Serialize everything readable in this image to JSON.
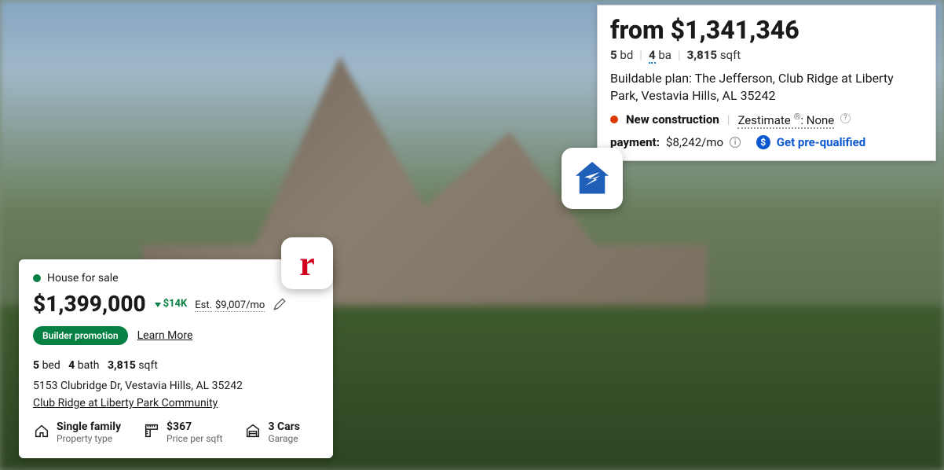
{
  "realtor": {
    "status": "House for sale",
    "price": "$1,399,000",
    "delta": "$14K",
    "est_label": "Est.",
    "est_value": "$9,007/mo",
    "promo_badge": "Builder promotion",
    "learn_more": "Learn More",
    "beds_value": "5",
    "beds_label": "bed",
    "baths_value": "4",
    "baths_label": "bath",
    "sqft_value": "3,815",
    "sqft_label": "sqft",
    "address": "5153 Clubridge Dr, Vestavia Hills, AL 35242",
    "community": "Club Ridge at Liberty Park Community",
    "meta": {
      "type_value": "Single family",
      "type_label": "Property type",
      "ppsf_value": "$367",
      "ppsf_label": "Price per sqft",
      "garage_value": "3 Cars",
      "garage_label": "Garage"
    }
  },
  "zillow": {
    "price_prefix": "from",
    "price": "$1,341,346",
    "beds_value": "5",
    "beds_label": "bd",
    "baths_value": "4",
    "baths_label": "ba",
    "sqft_value": "3,815",
    "sqft_label": "sqft",
    "description": "Buildable plan: The Jefferson, Club Ridge at Liberty Park, Vestavia Hills, AL 35242",
    "tag": "New construction",
    "zestimate_label": "Zestimate",
    "zestimate_value": "None",
    "payment_label": "payment:",
    "payment_value": "$8,242/mo",
    "cta": "Get pre-qualified"
  },
  "logos": {
    "realtor_letter": "r"
  }
}
